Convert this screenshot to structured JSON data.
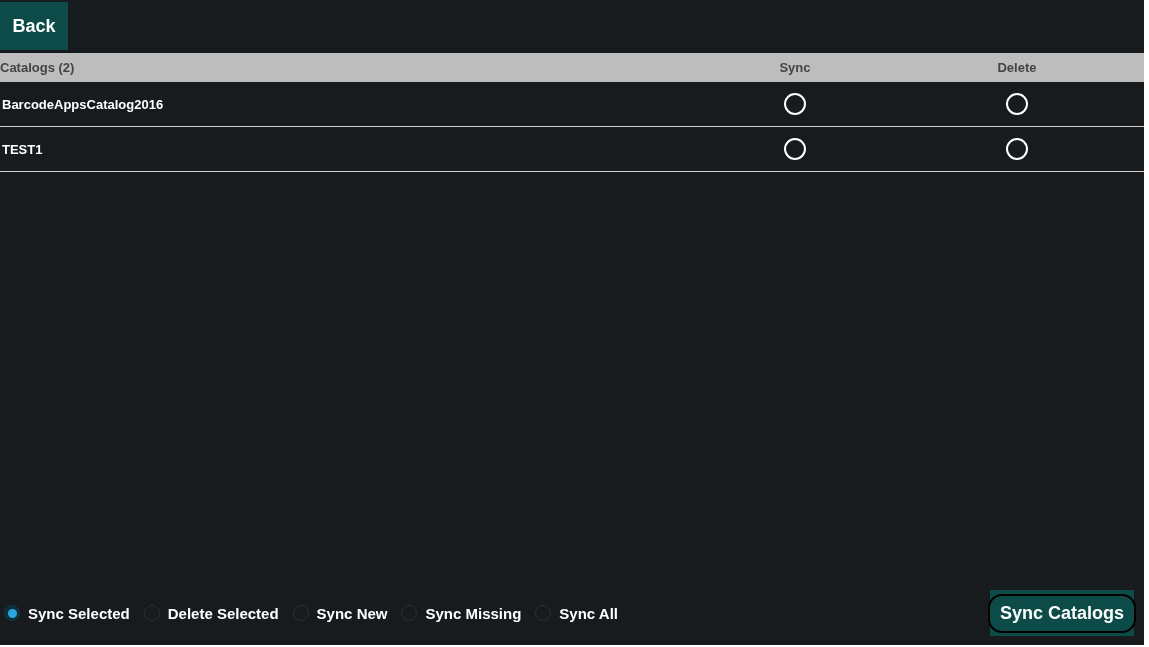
{
  "back_button": "Back",
  "table": {
    "columns": [
      "Catalogs (2)",
      "Sync",
      "Delete"
    ],
    "rows": [
      {
        "name": "BarcodeAppsCatalog2016",
        "sync": false,
        "delete": false
      },
      {
        "name": "TEST1",
        "sync": false,
        "delete": false
      }
    ]
  },
  "modes": [
    {
      "label": "Sync Selected",
      "selected": true
    },
    {
      "label": "Delete Selected",
      "selected": false
    },
    {
      "label": "Sync New",
      "selected": false
    },
    {
      "label": "Sync Missing",
      "selected": false
    },
    {
      "label": "Sync All",
      "selected": false
    }
  ],
  "action_button": "Sync Catalogs"
}
